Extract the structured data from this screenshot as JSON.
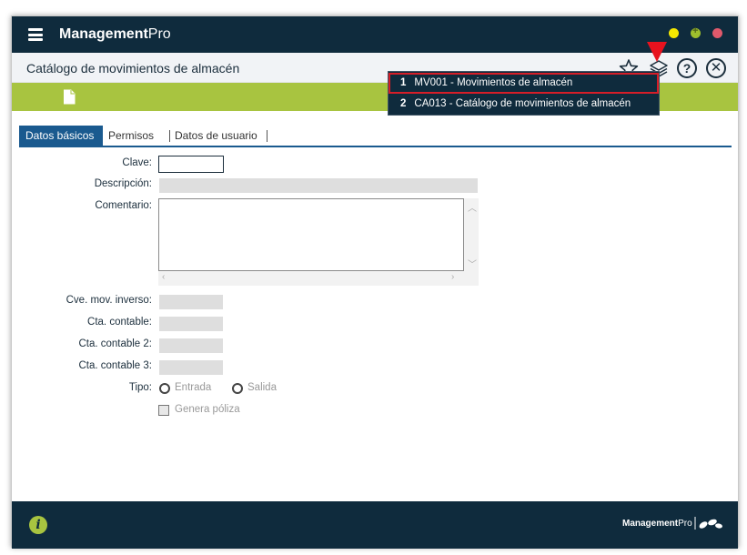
{
  "app": {
    "brand_bold": "Management",
    "brand_light": "Pro"
  },
  "window": {
    "title": "Catálogo de movimientos de almacén"
  },
  "dropdown": {
    "items": [
      {
        "num": "1",
        "label": "MV001 - Movimientos de almacén"
      },
      {
        "num": "2",
        "label": "CA013 - Catálogo de movimientos de almacén"
      }
    ]
  },
  "tabs": [
    {
      "label": "Datos básicos"
    },
    {
      "label": "Permisos"
    },
    {
      "label": "Datos de usuario"
    }
  ],
  "form": {
    "clave": "Clave:",
    "descripcion": "Descripción:",
    "comentario": "Comentario:",
    "cve_mov_inverso": "Cve. mov. inverso:",
    "cta_contable": "Cta. contable:",
    "cta_contable_2": "Cta. contable 2:",
    "cta_contable_3": "Cta. contable 3:",
    "tipo": "Tipo:",
    "tipo_options": [
      "Entrada",
      "Salida"
    ],
    "genera_poliza": "Genera póliza"
  },
  "footer": {
    "brand_bold": "Management",
    "brand_light": "Pro"
  },
  "colors": {
    "topbar": "#0f2b3d",
    "toolbar_green": "#a8c440",
    "tab_active": "#1a5a8f",
    "highlight_red": "#d61e28"
  },
  "icons": [
    "hamburger-icon",
    "star-icon",
    "layers-icon",
    "help-icon",
    "close-icon",
    "new-document-icon",
    "info-icon"
  ]
}
